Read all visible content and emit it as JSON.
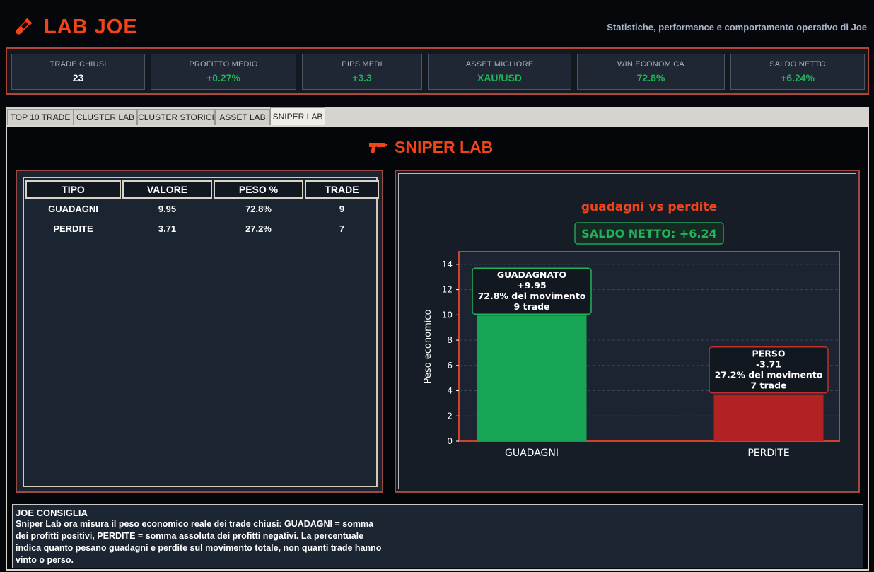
{
  "header": {
    "title": "LAB JOE",
    "subtitle": "Statistiche, performance e comportamento operativo di Joe",
    "accent": "#f24418"
  },
  "kpis": [
    {
      "label": "TRADE CHIUSI",
      "value": "23",
      "color": "#ffffff"
    },
    {
      "label": "PROFITTO MEDIO",
      "value": "+0.27%",
      "color": "#22b35a"
    },
    {
      "label": "PIPS MEDI",
      "value": "+3.3",
      "color": "#22b35a"
    },
    {
      "label": "ASSET MIGLIORE",
      "value": "XAU/USD",
      "color": "#22b35a"
    },
    {
      "label": "WIN ECONOMICA",
      "value": "72.8%",
      "color": "#22b35a"
    },
    {
      "label": "SALDO NETTO",
      "value": "+6.24%",
      "color": "#22b35a"
    }
  ],
  "tabs": [
    {
      "label": "TOP 10 TRADE",
      "active": false
    },
    {
      "label": "CLUSTER LAB",
      "active": false
    },
    {
      "label": "CLUSTER STORICI",
      "active": false
    },
    {
      "label": "ASSET LAB",
      "active": false
    },
    {
      "label": "SNIPER LAB",
      "active": true
    }
  ],
  "sniper": {
    "title": "SNIPER LAB",
    "icon": "pistol-icon"
  },
  "table": {
    "columns": [
      "TIPO",
      "VALORE",
      "PESO %",
      "TRADE"
    ],
    "rows": [
      [
        "GUADAGNI",
        "9.95",
        "72.8%",
        "9"
      ],
      [
        "PERDITE",
        "3.71",
        "27.2%",
        "7"
      ]
    ]
  },
  "chart_data": {
    "type": "bar",
    "title": "guadagni vs perdite",
    "subtitle": "SALDO NETTO: +6.24",
    "categories": [
      "GUADAGNI",
      "PERDITE"
    ],
    "values": [
      9.95,
      3.71
    ],
    "colors": [
      "#18a656",
      "#b32222"
    ],
    "ylabel": "Peso economico",
    "ylim": [
      0,
      15
    ],
    "yticks": [
      0,
      2,
      4,
      6,
      8,
      10,
      12,
      14
    ],
    "grid": true,
    "annotations": [
      {
        "lines": [
          "GUADAGNATO",
          "+9.95",
          "72.8% del movimento",
          "9 trade"
        ],
        "border": "#22b35a"
      },
      {
        "lines": [
          "PERSO",
          "-3.71",
          "27.2% del movimento",
          "7 trade"
        ],
        "border": "#c0302a"
      }
    ]
  },
  "advice": {
    "title": "JOE CONSIGLIA",
    "text": "Sniper Lab ora misura il peso economico reale dei trade chiusi: GUADAGNI = somma dei profitti positivi, PERDITE = somma assoluta dei profitti negativi. La percentuale indica quanto pesano guadagni e perdite sul movimento totale, non quanti trade hanno vinto o perso."
  }
}
